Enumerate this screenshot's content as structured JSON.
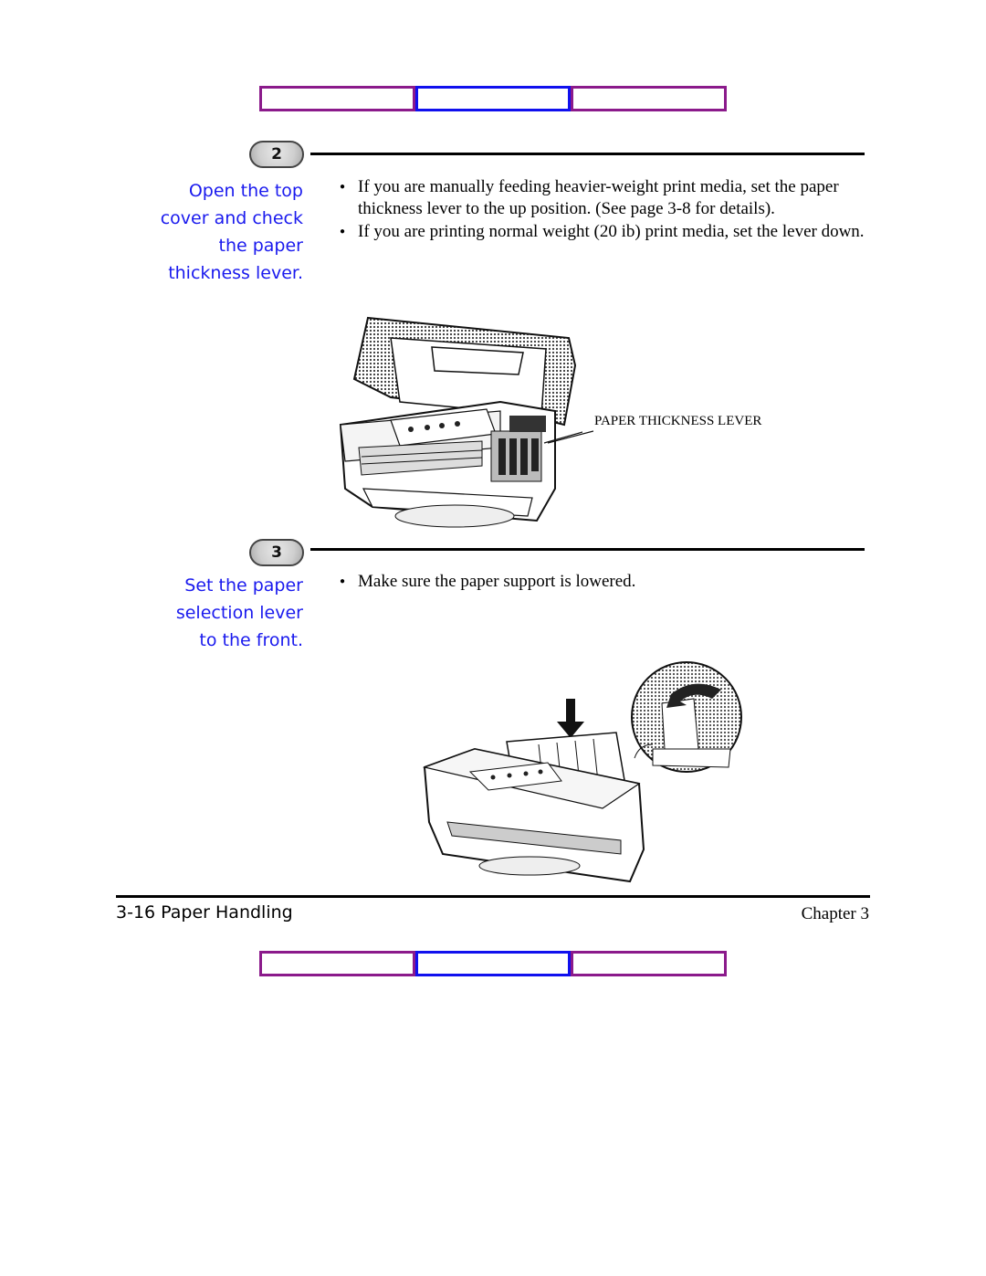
{
  "nav": {
    "top": [
      {
        "label": "",
        "color": "#8b1a8b"
      },
      {
        "label": "",
        "color": "#1010ee"
      },
      {
        "label": "",
        "color": "#8b1a8b"
      }
    ],
    "bottom": [
      {
        "label": "",
        "color": "#8b1a8b"
      },
      {
        "label": "",
        "color": "#1010ee"
      },
      {
        "label": "",
        "color": "#8b1a8b"
      }
    ]
  },
  "steps": [
    {
      "number": "2",
      "title_lines": [
        "Open the top",
        "cover and check",
        "the paper",
        "thickness lever."
      ],
      "bullets": [
        "If you are manually feeding heavier-weight print media, set the paper thickness lever to the up position. (See page 3-8 for details).",
        "If you are printing normal weight (20 ib) print media, set the lever down."
      ],
      "figure": {
        "description": "Printer with top cover open",
        "callout": "PAPER THICKNESS LEVER"
      }
    },
    {
      "number": "3",
      "title_lines": [
        "Set the paper",
        "selection lever",
        "to the front."
      ],
      "bullets": [
        "Make sure the paper support is lowered."
      ],
      "figure": {
        "description": "Printer with paper support and magnified lever inset"
      }
    }
  ],
  "footer": {
    "left": "3-16 Paper Handling",
    "right": "Chapter 3"
  },
  "colors": {
    "title_blue": "#1a1aee",
    "nav_purple": "#8b1a8b",
    "nav_blue": "#1010ee"
  }
}
